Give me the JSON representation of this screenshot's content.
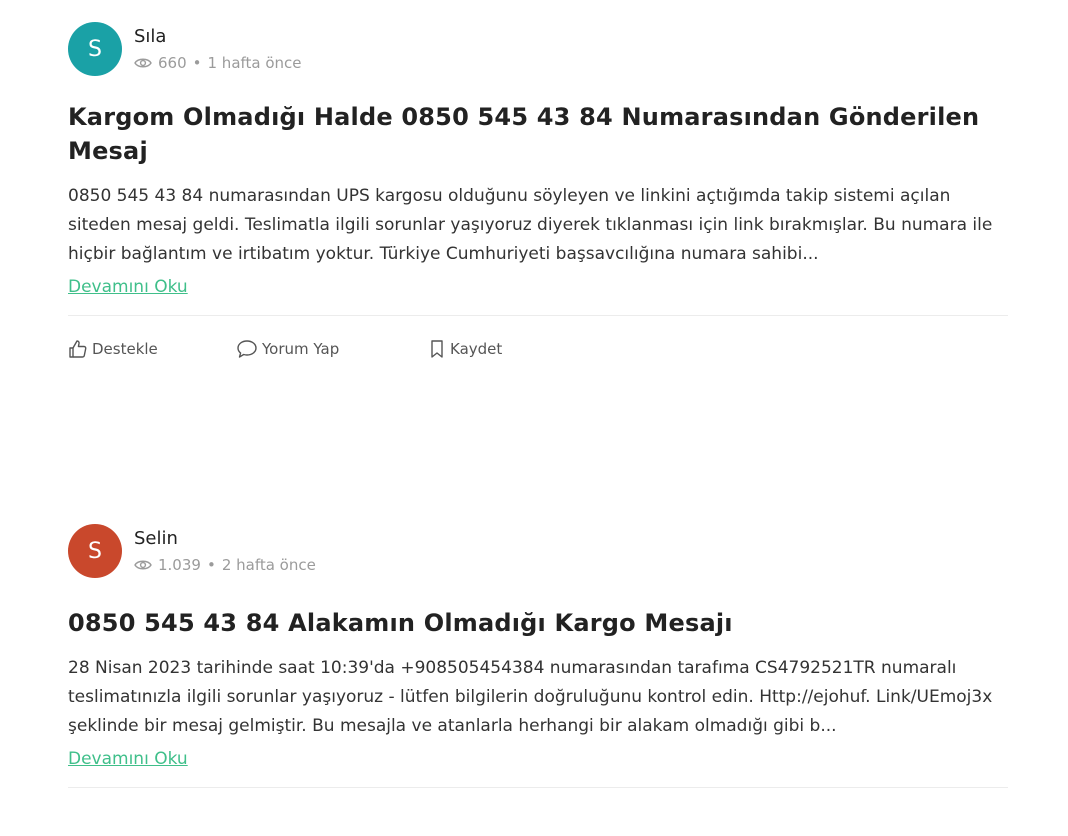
{
  "colors": {
    "accent_link": "#3fbf8a",
    "avatar_1": "#1aa1a6",
    "avatar_2": "#c9482c"
  },
  "posts": [
    {
      "author": "Sıla",
      "avatar_letter": "S",
      "avatar_color": "#1aa1a6",
      "views": "660",
      "separator": "•",
      "time": "1 hafta önce",
      "title": "Kargom Olmadığı Halde 0850 545 43 84 Numarasından Gönderilen Mesaj",
      "body": "0850 545 43 84 numarasından UPS kargosu olduğunu söyleyen ve linkini açtığımda takip sistemi açılan siteden mesaj geldi. Teslimatla ilgili sorunlar yaşıyoruz diyerek tıklanması için link bırakmışlar. Bu numara ile hiçbir bağlantım ve irtibatım yoktur. Türkiye Cumhuriyeti başsavcılığına numara sahibi...",
      "read_more": "Devamını Oku",
      "actions": {
        "like": "Destekle",
        "comment": "Yorum Yap",
        "save": "Kaydet"
      }
    },
    {
      "author": "Selin",
      "avatar_letter": "S",
      "avatar_color": "#c9482c",
      "views": "1.039",
      "separator": "•",
      "time": "2 hafta önce",
      "title": "0850 545 43 84 Alakamın Olmadığı Kargo Mesajı",
      "body": "28 Nisan 2023 tarihinde saat 10:39'da +908505454384 numarasından tarafıma CS4792521TR numaralı teslimatınızla ilgili sorunlar yaşıyoruz - lütfen bilgilerin doğruluğunu kontrol edin. Http://ejohuf. Link/UEmoj3x şeklinde bir mesaj gelmiştir. Bu mesajla ve atanlarla herhangi bir alakam olmadığı gibi b...",
      "read_more": "Devamını Oku"
    }
  ]
}
